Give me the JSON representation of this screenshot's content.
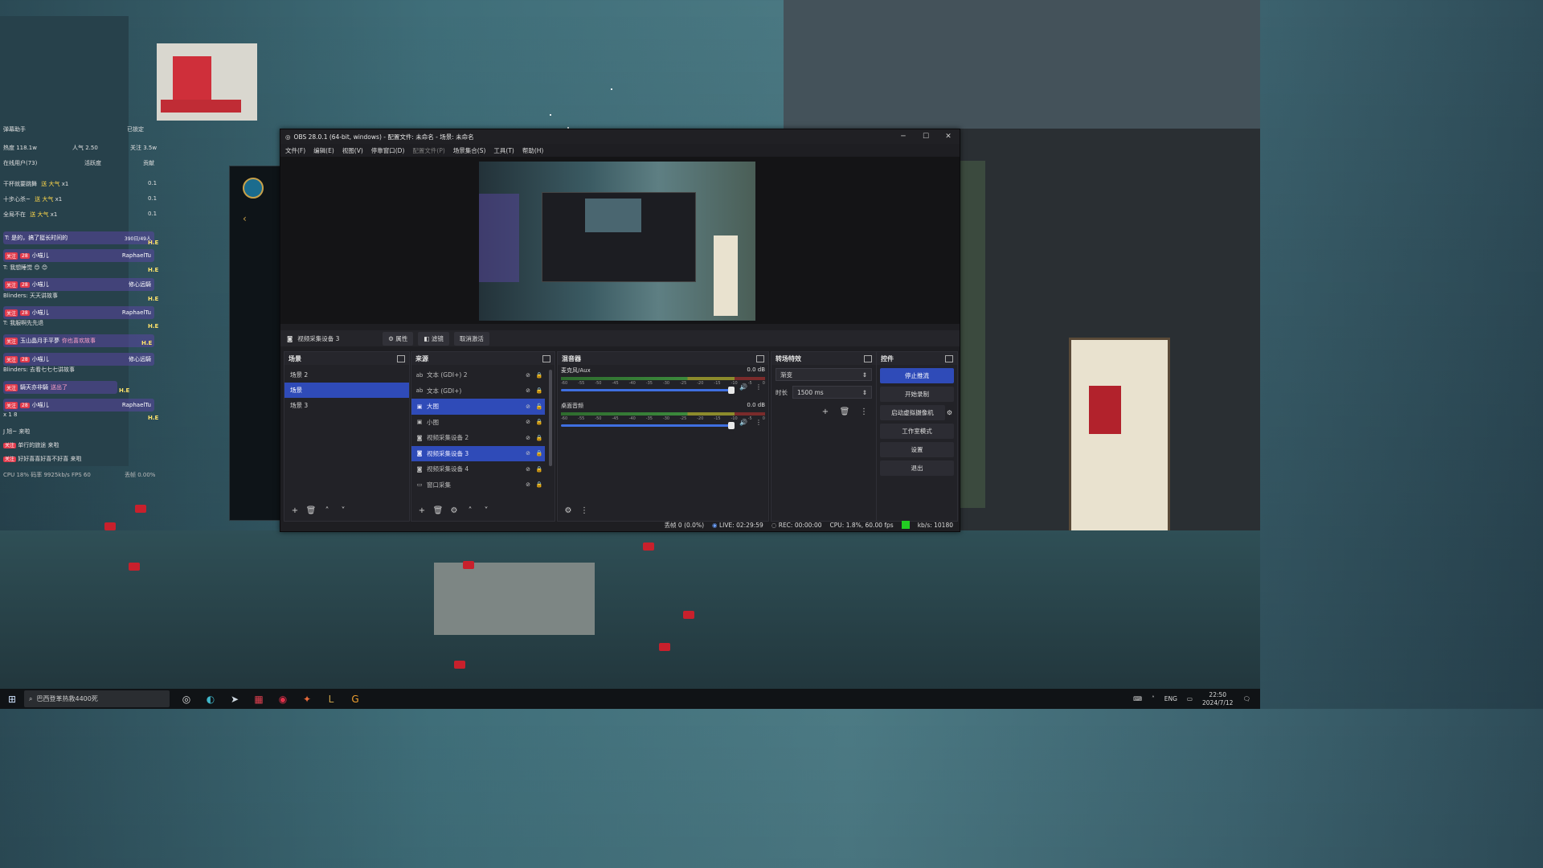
{
  "stream_panel": {
    "title": "弹幕助手",
    "status": "已锁定",
    "heat_label": "热度 118.1w",
    "viewers_label": "人气 2.50",
    "followers_label": "关注 3.5w",
    "online_label": "在线用户(73)",
    "activity_label": "活跃度",
    "status_right": "贡献",
    "gift_rows": [
      {
        "user": "干杯就要跳舞",
        "action": "送 大气",
        "count": "x1",
        "val": "0.1"
      },
      {
        "user": "十步心杀~",
        "action": "送 大气",
        "count": "x1",
        "val": "0.1"
      },
      {
        "user": "全局不在",
        "action": "送 大气",
        "count": "x1",
        "val": "0.1"
      }
    ],
    "chat": [
      {
        "text": "T: 是的，搞了挺长时间的",
        "extra": "390日/49人"
      },
      {
        "user": "RaphaelTu",
        "text": "T: 我想睡觉 😊 😊"
      },
      {
        "user": "修心远騎",
        "text": "Blinders: 天天讲故事"
      },
      {
        "user": "RaphaelTu",
        "text": "T: 我服啊先先退"
      },
      {
        "user": "玉山晶月手平夢",
        "text": "你也喜欢故事"
      },
      {
        "user": "修心远騎",
        "text": "Blinders: 去看七七七讲故事"
      },
      {
        "user": "騎天亦非騎",
        "text": "送出了"
      },
      {
        "user": "RaphaelTu",
        "text": "x 1 8"
      }
    ],
    "he_tag": "H.E",
    "bottom_rows": [
      {
        "text": "J 旭~ 来啦"
      },
      {
        "text": "单行的旅途 来啦"
      },
      {
        "text": "好好喜喜好喜不好喜 来啦"
      }
    ],
    "perf": "CPU 18%   码率 9925kb/s  FPS 60",
    "drop": "丢帧 0.00%",
    "badge_follow": "关注",
    "badge_level": "28",
    "badge_name": "小喵儿"
  },
  "obs": {
    "title": "OBS 28.0.1 (64-bit, windows) - 配置文件: 未命名 - 场景: 未命名",
    "menu": [
      "文件(F)",
      "编辑(E)",
      "视图(V)",
      "停靠窗口(D)",
      "配置文件(P)",
      "场景集合(S)",
      "工具(T)",
      "帮助(H)"
    ],
    "source_bar": {
      "current_source": "视频采集设备 3",
      "properties": "属性",
      "filters": "滤镜",
      "deactivate": "取消激活"
    },
    "scenes": {
      "title": "场景",
      "items": [
        "场景 2",
        "场景",
        "场景 3"
      ],
      "selected": 1
    },
    "sources": {
      "title": "来源",
      "items": [
        {
          "label": "文本 (GDI+) 2",
          "icon": "text-icon"
        },
        {
          "label": "文本 (GDI+)",
          "icon": "text-icon"
        },
        {
          "label": "大图",
          "icon": "image-icon"
        },
        {
          "label": "小图",
          "icon": "image-icon"
        },
        {
          "label": "视频采集设备 2",
          "icon": "camera-icon"
        },
        {
          "label": "视频采集设备 3",
          "icon": "camera-icon"
        },
        {
          "label": "视频采集设备 4",
          "icon": "camera-icon"
        },
        {
          "label": "窗口采集",
          "icon": "window-icon"
        }
      ]
    },
    "mixer": {
      "title": "混音器",
      "channels": [
        {
          "name": "麦克风/Aux",
          "db": "0.0 dB"
        },
        {
          "name": "桌面音频",
          "db": "0.0 dB"
        }
      ],
      "ticks": [
        "-60",
        "-55",
        "-50",
        "-45",
        "-40",
        "-35",
        "-30",
        "-25",
        "-20",
        "-15",
        "-10",
        "-5",
        "0"
      ]
    },
    "transitions": {
      "title": "转场特效",
      "selected": "渐变",
      "duration_label": "时长",
      "duration_value": "1500 ms"
    },
    "controls": {
      "title": "控件",
      "stop_stream": "停止推流",
      "start_record": "开始录制",
      "virtual_cam": "启动虚拟摄像机",
      "studio_mode": "工作室模式",
      "settings": "设置",
      "exit": "退出"
    },
    "status": {
      "dropped": "丢帧 0 (0.0%)",
      "live": "LIVE: 02:29:59",
      "rec": "REC: 00:00:00",
      "cpu": "CPU: 1.8%, 60.00 fps",
      "kbps": "kb/s: 10180"
    }
  },
  "taskbar": {
    "search": "巴西登革热救4400死",
    "lang": "ENG",
    "time": "22:50",
    "date": "2024/7/12"
  },
  "colors": {
    "obs_bg": "#1e1e22",
    "accent_blue": "#2f4bb8",
    "stream_green": "#22cc22",
    "lantern_red": "#c8202c"
  }
}
